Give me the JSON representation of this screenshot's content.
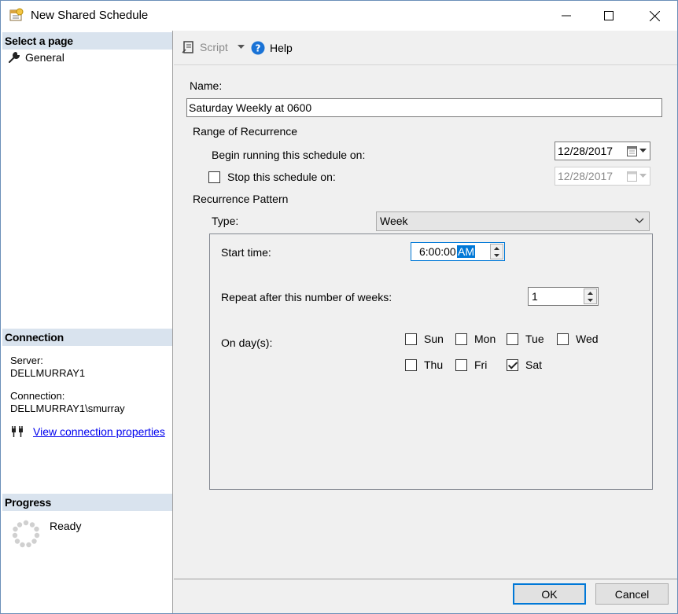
{
  "window": {
    "title": "New Shared Schedule",
    "minimize_glyph": "—",
    "maximize_glyph": "☐",
    "close_glyph": "✕"
  },
  "sidebar": {
    "select_page_header": "Select a page",
    "pages": [
      {
        "label": "General",
        "icon": "wrench-icon"
      }
    ],
    "connection_header": "Connection",
    "server_label": "Server:",
    "server_value": "DELLMURRAY1",
    "connection_label": "Connection:",
    "connection_value": "DELLMURRAY1\\smurray",
    "view_properties_link": "View connection properties",
    "progress_header": "Progress",
    "progress_status": "Ready"
  },
  "toolbar": {
    "script_label": "Script",
    "help_label": "Help"
  },
  "form": {
    "name_label": "Name:",
    "name_value": "Saturday Weekly at 0600",
    "range_label": "Range of Recurrence",
    "begin_label": "Begin running this schedule on:",
    "begin_date": "12/28/2017",
    "stop_label": "Stop this schedule on:",
    "stop_checked": false,
    "stop_date": "12/28/2017",
    "pattern_label": "Recurrence Pattern",
    "type_label": "Type:",
    "type_value": "Week",
    "start_time_label": "Start time:",
    "start_time_value": "6:00:00",
    "start_time_ampm": "AM",
    "repeat_label": "Repeat after this number of weeks:",
    "repeat_value": "1",
    "days_label": "On day(s):",
    "days": [
      {
        "label": "Sun",
        "checked": false
      },
      {
        "label": "Mon",
        "checked": false
      },
      {
        "label": "Tue",
        "checked": false
      },
      {
        "label": "Wed",
        "checked": false
      },
      {
        "label": "Thu",
        "checked": false
      },
      {
        "label": "Fri",
        "checked": false
      },
      {
        "label": "Sat",
        "checked": true
      }
    ]
  },
  "footer": {
    "ok_label": "OK",
    "cancel_label": "Cancel"
  },
  "colors": {
    "accent": "#0078d7",
    "link": "#0000ee",
    "section_header": "#d9e3ee"
  }
}
